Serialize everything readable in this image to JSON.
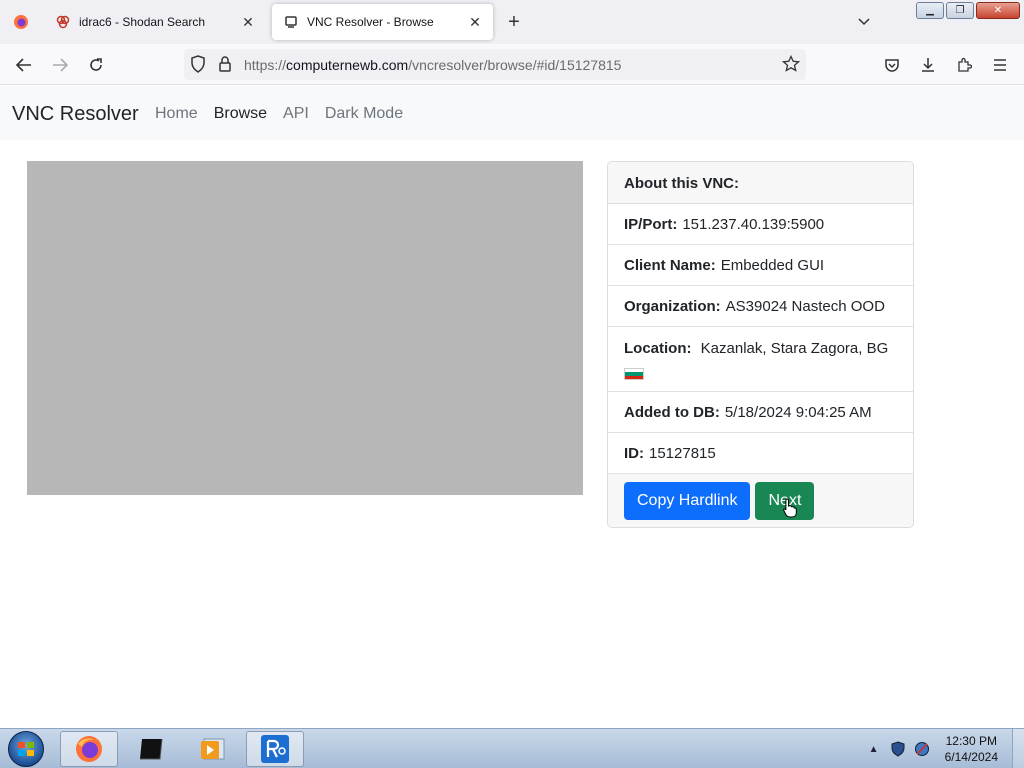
{
  "browser": {
    "tabs": [
      {
        "label": "idrac6 - Shodan Search",
        "icon": "shodan-icon"
      },
      {
        "label": "VNC Resolver - Browse",
        "icon": "vnc-resolver-icon",
        "active": true
      }
    ],
    "url_prefix": "https://",
    "url_host": "computernewb.com",
    "url_path": "/vncresolver/browse/#id/15127815"
  },
  "site": {
    "brand": "VNC Resolver",
    "nav": [
      {
        "label": "Home"
      },
      {
        "label": "Browse",
        "active": true
      },
      {
        "label": "API"
      },
      {
        "label": "Dark Mode"
      }
    ]
  },
  "vnc": {
    "header": "About this VNC:",
    "ip_label": "IP/Port:",
    "ip_value": "151.237.40.139:5900",
    "client_label": "Client Name:",
    "client_value": "Embedded GUI",
    "org_label": "Organization:",
    "org_value": "AS39024 Nastech OOD",
    "location_label": "Location:",
    "location_value": "Kazanlak, Stara Zagora, BG",
    "flag_colors": [
      "#ffffff",
      "#00966e",
      "#d62612"
    ],
    "added_label": "Added to DB:",
    "added_value": "5/18/2024 9:04:25 AM",
    "id_label": "ID:",
    "id_value": "15127815",
    "copy_button": "Copy Hardlink",
    "next_button": "Next"
  },
  "taskbar": {
    "clock_time": "12:30 PM",
    "clock_date": "6/14/2024",
    "items": [
      "firefox-icon",
      "terminal-icon",
      "media-player-icon",
      "vnc-resolver-app-icon"
    ]
  },
  "colors": {
    "primary": "#0d6efd",
    "success": "#198754",
    "screenshot_placeholder": "#b7b7b7"
  }
}
